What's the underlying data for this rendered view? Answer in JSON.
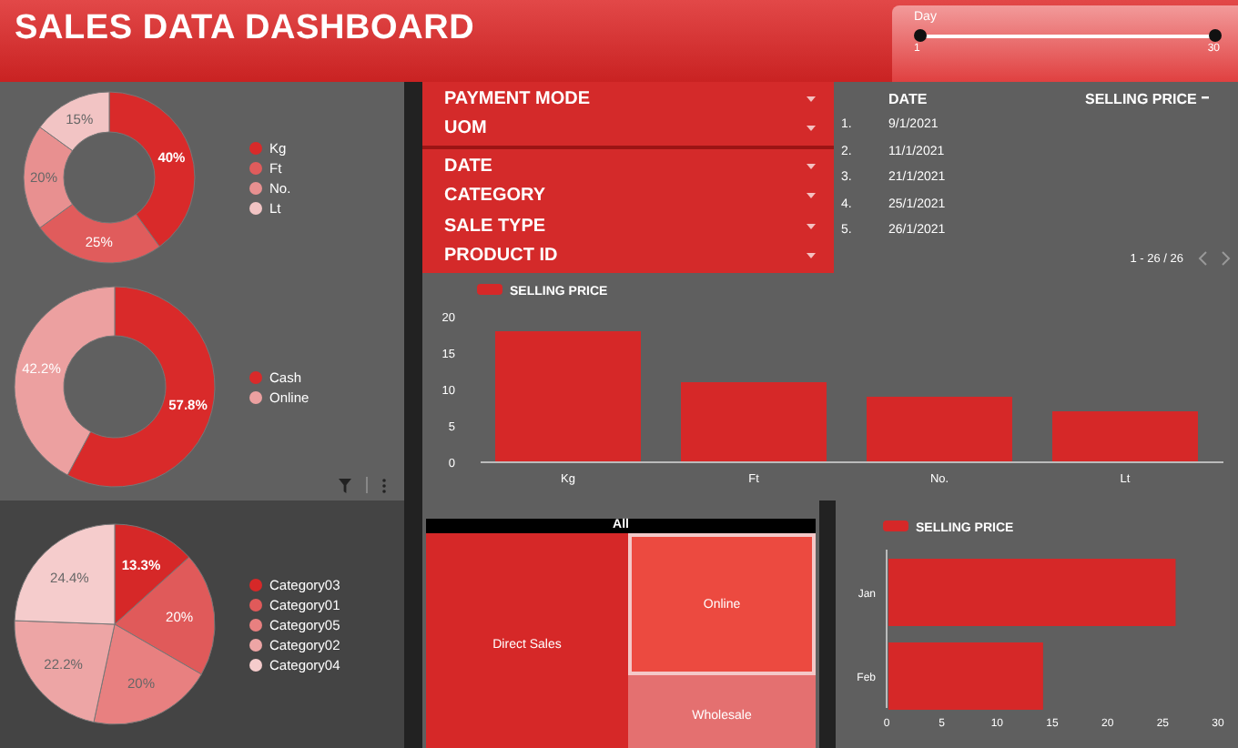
{
  "header": {
    "title": "SALES DATA DASHBOARD"
  },
  "day_slider": {
    "label": "Day",
    "thumbs": [
      {
        "label": "1",
        "level": 0
      },
      {
        "label": "30",
        "level": 1
      }
    ]
  },
  "pies": [
    {
      "chart_data": {
        "type": "donut",
        "categories": [
          "Kg",
          "Ft",
          "No.",
          "Lt"
        ],
        "values": [
          40,
          25,
          20,
          15
        ],
        "value_labels": [
          "40%",
          "25%",
          "20%",
          "15%"
        ],
        "colors": [
          "#d92a2a",
          "#e05c5c",
          "#e89090",
          "#f2c4c4"
        ]
      }
    },
    {
      "chart_data": {
        "type": "donut",
        "categories": [
          "Cash",
          "Online"
        ],
        "values": [
          57.8,
          42.2
        ],
        "value_labels": [
          "57.8%",
          "42.2%"
        ],
        "colors": [
          "#d92a2a",
          "#eca0a0"
        ]
      }
    },
    {
      "chart_data": {
        "type": "pie",
        "categories": [
          "Category03",
          "Category01",
          "Category05",
          "Category02",
          "Category04"
        ],
        "values": [
          13.3,
          20,
          20,
          22.2,
          24.4
        ],
        "value_labels": [
          "13.3%",
          "20%",
          "20%",
          "22.2%",
          "24.4%"
        ],
        "colors": [
          "#d62828",
          "#e05a5a",
          "#e88080",
          "#eda5a5",
          "#f5cccc"
        ]
      }
    }
  ],
  "filters": [
    [
      "PAYMENT MODE",
      "UOM"
    ],
    [
      "DATE",
      "CATEGORY",
      "SALE TYPE",
      "PRODUCT ID"
    ]
  ],
  "table": {
    "columns": [
      "DATE",
      "SELLING PRICE"
    ],
    "rows": [
      {
        "index": "1.",
        "date": "9/1/2021"
      },
      {
        "index": "2.",
        "date": "11/1/2021"
      },
      {
        "index": "3.",
        "date": "21/1/2021"
      },
      {
        "index": "4.",
        "date": "25/1/2021"
      },
      {
        "index": "5.",
        "date": "26/1/2021"
      }
    ],
    "pagination": "1 - 26 / 26"
  },
  "bar_chart": {
    "chart_data": {
      "type": "bar",
      "categories": [
        "Kg",
        "Ft",
        "No.",
        "Lt"
      ],
      "series": [
        {
          "name": "SELLING PRICE",
          "color": "#d62828",
          "values": [
            18,
            11,
            9,
            7
          ]
        }
      ],
      "yticks": [
        0,
        5,
        10,
        15,
        20
      ],
      "ylim": [
        0,
        20
      ]
    }
  },
  "treemap": {
    "root": "All",
    "items": [
      "Direct Sales",
      "Online",
      "Wholesale"
    ]
  },
  "hbar_chart": {
    "chart_data": {
      "type": "bar",
      "orientation": "horizontal",
      "categories": [
        "Jan",
        "Feb"
      ],
      "series": [
        {
          "name": "SELLING PRICE",
          "color": "#d62828",
          "values": [
            26,
            14
          ]
        }
      ],
      "xticks": [
        0,
        5,
        10,
        15,
        20,
        25,
        30
      ],
      "xlim": [
        0,
        30
      ]
    }
  }
}
